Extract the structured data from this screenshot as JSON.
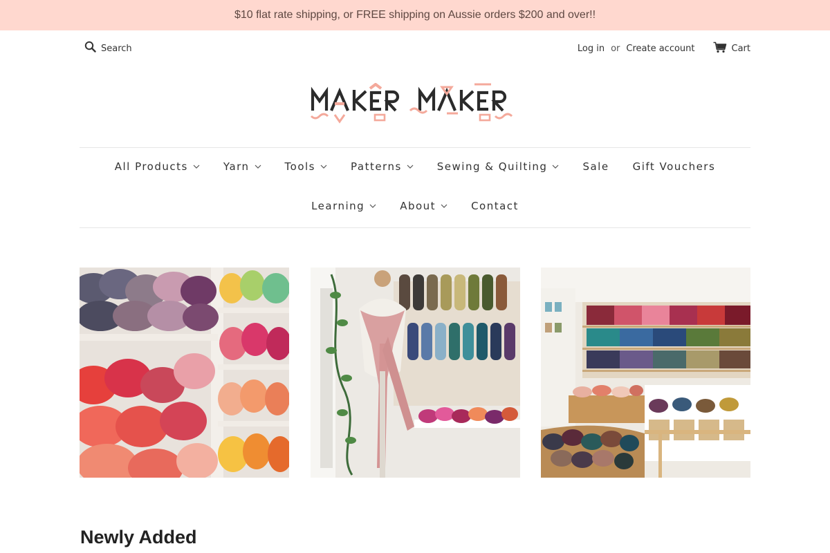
{
  "announcement": "$10 flat rate shipping, or FREE shipping on Aussie orders $200 and over!!",
  "header": {
    "search_placeholder": "Search",
    "login": "Log in",
    "or": "or",
    "create_account": "Create account",
    "cart": "Cart"
  },
  "logo": {
    "text": "MAKER MAKER"
  },
  "nav": {
    "row1": [
      "All Products",
      "Yarn",
      "Tools",
      "Patterns",
      "Sewing & Quilting",
      "Sale",
      "Gift Vouchers"
    ],
    "row2": [
      "Learning",
      "About",
      "Contact"
    ],
    "dropdowns": {
      "All Products": true,
      "Yarn": true,
      "Tools": true,
      "Patterns": true,
      "Sewing & Quilting": true,
      "Learning": true,
      "About": true
    }
  },
  "tiles": [
    {
      "icon": "yarn-shelves-image"
    },
    {
      "icon": "mannequin-shawl-image"
    },
    {
      "icon": "yarn-store-wall-image"
    }
  ],
  "colors": {
    "announcement_bg": "#ffd8cf",
    "logo_pink": "#f4a99b",
    "logo_dark": "#2b2b2b"
  },
  "section_title": "Newly Added"
}
